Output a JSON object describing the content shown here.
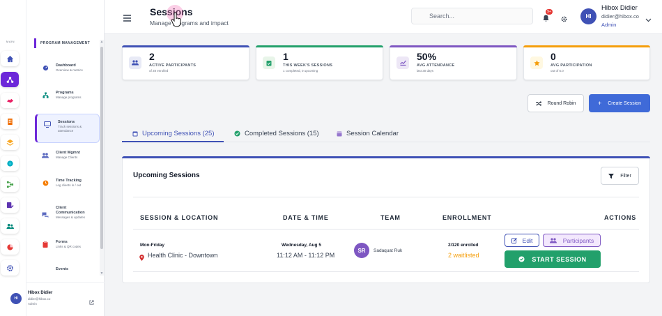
{
  "rail": {
    "main_label": "MAIN"
  },
  "sidebar": {
    "section_title": "PROGRAM MANAGEMENT",
    "items": [
      {
        "title": "Dashboard",
        "sub": "Overview & metrics"
      },
      {
        "title": "Programs",
        "sub": "Manage programs"
      },
      {
        "title": "Sessions",
        "sub": "Track sessions & attendance"
      },
      {
        "title": "Client Mgmnt",
        "sub": "Manage Clients"
      },
      {
        "title": "Time Tracking",
        "sub": "Log clients in / out"
      },
      {
        "title": "Client Communication",
        "sub": "Messages & updates"
      },
      {
        "title": "Forms",
        "sub": "Links & QR codes"
      },
      {
        "title": "Events",
        "sub": ""
      }
    ],
    "footer": {
      "initials": "HI",
      "name": "Hibox Didier",
      "email": "didier@hibox.co",
      "role": "Admin"
    }
  },
  "header": {
    "title": "Sessions",
    "subtitle": "Manage programs and impact",
    "search_placeholder": "Search...",
    "notif_count": "9+",
    "user": {
      "initials": "HI",
      "name": "Hibox Didier",
      "email": "didier@hibox.co",
      "role": "Admin"
    }
  },
  "stats": [
    {
      "value": "2",
      "label": "ACTIVE PARTICIPANTS",
      "sub": "of 28 enrolled",
      "color": "#3f51b5"
    },
    {
      "value": "1",
      "label": "THIS WEEK'S SESSIONS",
      "sub": "1 completed, 0 upcoming",
      "color": "#22a06b"
    },
    {
      "value": "50%",
      "label": "AVG ATTENDANCE",
      "sub": "last 30 days",
      "color": "#7e57c2"
    },
    {
      "value": "0",
      "label": "AVG PARTICIPATION",
      "sub": "out of 5.0",
      "color": "#f59e0b"
    }
  ],
  "actions": {
    "round_robin": "Round Robin",
    "create_session": "Create Session"
  },
  "tabs": [
    {
      "label": "Upcoming Sessions (25)"
    },
    {
      "label": "Completed Sessions (15)"
    },
    {
      "label": "Session Calendar"
    }
  ],
  "section": {
    "title": "Upcoming Sessions",
    "filter": "Filter"
  },
  "table": {
    "headers": [
      "SESSION & LOCATION",
      "DATE & TIME",
      "TEAM",
      "ENROLLMENT",
      "ACTIONS"
    ],
    "rows": [
      {
        "schedule": "Mon-Friday",
        "location": "Health Clinic - Downtown",
        "date": "Wednesday, Aug 5",
        "time": "11:12 AM - 11:12 PM",
        "team_initials": "SR",
        "team_name": "Sadaquat Ruk",
        "enrolled": "2/120 enrolled",
        "waitlisted": "2 waitlisted",
        "edit": "Edit",
        "participants": "Participants",
        "start": "START SESSION"
      }
    ]
  }
}
